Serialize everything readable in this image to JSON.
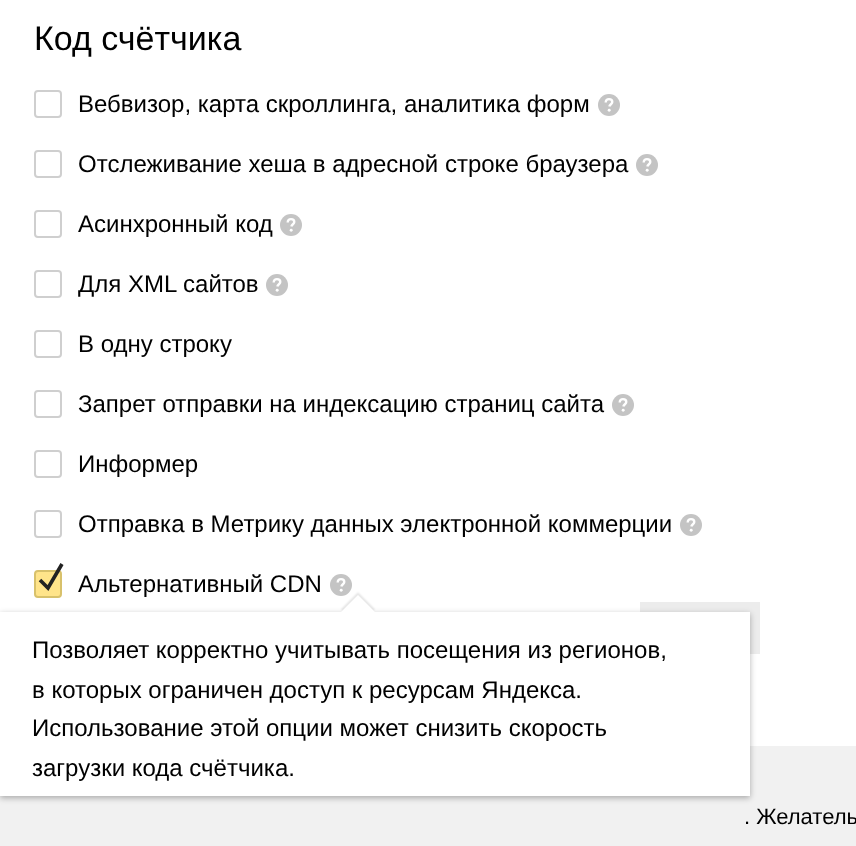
{
  "title": "Код счётчика",
  "options": [
    {
      "label": "Вебвизор, карта скроллинга, аналитика форм",
      "checked": false,
      "help": true
    },
    {
      "label": "Отслеживание хеша в адресной строке браузера",
      "checked": false,
      "help": true
    },
    {
      "label": "Асинхронный код",
      "checked": false,
      "help": true
    },
    {
      "label": "Для XML сайтов",
      "checked": false,
      "help": true
    },
    {
      "label": "В одну строку",
      "checked": false,
      "help": false
    },
    {
      "label": "Запрет отправки на индексацию страниц сайта",
      "checked": false,
      "help": true
    },
    {
      "label": "Информер",
      "checked": false,
      "help": false
    },
    {
      "label": "Отправка в Метрику данных электронной коммерции",
      "checked": false,
      "help": true
    },
    {
      "label": "Альтернативный CDN",
      "checked": true,
      "help": true
    }
  ],
  "tooltip": {
    "text": "Позволяет корректно учитывать посещения из регионов, в которых ограничен доступ к ресурсам Яндекса. Использование этой опции может снизить скорость загрузки кода счётчика."
  },
  "background_text": ". Желатель"
}
